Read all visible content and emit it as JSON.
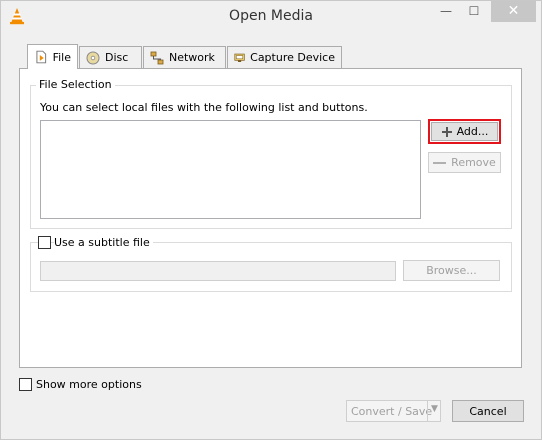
{
  "window": {
    "title": "Open Media",
    "controls": {
      "minimize": "—",
      "maximize": "☐",
      "close": "✕"
    }
  },
  "tabs": [
    {
      "label": "File",
      "icon": "file-icon",
      "active": true
    },
    {
      "label": "Disc",
      "icon": "disc-icon",
      "active": false
    },
    {
      "label": "Network",
      "icon": "network-icon",
      "active": false
    },
    {
      "label": "Capture Device",
      "icon": "capture-device-icon",
      "active": false
    }
  ],
  "file_selection": {
    "group_label": "File Selection",
    "description": "You can select local files with the following list and buttons.",
    "add_button": "Add...",
    "remove_button": "Remove"
  },
  "subtitle": {
    "checkbox_label": "Use a subtitle file",
    "checked": false,
    "file_value": "",
    "browse_button": "Browse..."
  },
  "footer": {
    "show_more_label": "Show more options",
    "show_more_checked": false,
    "convert_button": "Convert / Save",
    "cancel_button": "Cancel"
  },
  "colors": {
    "highlight": "#e3141c",
    "vlc_orange": "#f28c00"
  }
}
